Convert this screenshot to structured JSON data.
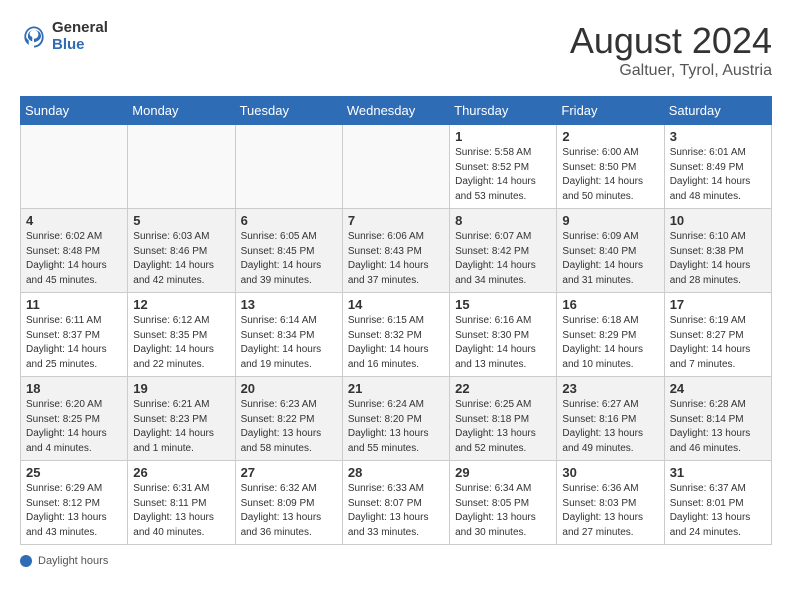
{
  "header": {
    "logo_general": "General",
    "logo_blue": "Blue",
    "month_title": "August 2024",
    "location": "Galtuer, Tyrol, Austria"
  },
  "weekdays": [
    "Sunday",
    "Monday",
    "Tuesday",
    "Wednesday",
    "Thursday",
    "Friday",
    "Saturday"
  ],
  "days": [
    {
      "date": "",
      "empty": true
    },
    {
      "date": "",
      "empty": true
    },
    {
      "date": "",
      "empty": true
    },
    {
      "date": "",
      "empty": true
    },
    {
      "date": "1",
      "sunrise": "5:58 AM",
      "sunset": "8:52 PM",
      "hours": "14 hours",
      "minutes": "and 53 minutes."
    },
    {
      "date": "2",
      "sunrise": "6:00 AM",
      "sunset": "8:50 PM",
      "hours": "14 hours",
      "minutes": "and 50 minutes."
    },
    {
      "date": "3",
      "sunrise": "6:01 AM",
      "sunset": "8:49 PM",
      "hours": "14 hours",
      "minutes": "and 48 minutes."
    },
    {
      "date": "4",
      "sunrise": "6:02 AM",
      "sunset": "8:48 PM",
      "hours": "14 hours",
      "minutes": "and 45 minutes."
    },
    {
      "date": "5",
      "sunrise": "6:03 AM",
      "sunset": "8:46 PM",
      "hours": "14 hours",
      "minutes": "and 42 minutes."
    },
    {
      "date": "6",
      "sunrise": "6:05 AM",
      "sunset": "8:45 PM",
      "hours": "14 hours",
      "minutes": "and 39 minutes."
    },
    {
      "date": "7",
      "sunrise": "6:06 AM",
      "sunset": "8:43 PM",
      "hours": "14 hours",
      "minutes": "and 37 minutes."
    },
    {
      "date": "8",
      "sunrise": "6:07 AM",
      "sunset": "8:42 PM",
      "hours": "14 hours",
      "minutes": "and 34 minutes."
    },
    {
      "date": "9",
      "sunrise": "6:09 AM",
      "sunset": "8:40 PM",
      "hours": "14 hours",
      "minutes": "and 31 minutes."
    },
    {
      "date": "10",
      "sunrise": "6:10 AM",
      "sunset": "8:38 PM",
      "hours": "14 hours",
      "minutes": "and 28 minutes."
    },
    {
      "date": "11",
      "sunrise": "6:11 AM",
      "sunset": "8:37 PM",
      "hours": "14 hours",
      "minutes": "and 25 minutes."
    },
    {
      "date": "12",
      "sunrise": "6:12 AM",
      "sunset": "8:35 PM",
      "hours": "14 hours",
      "minutes": "and 22 minutes."
    },
    {
      "date": "13",
      "sunrise": "6:14 AM",
      "sunset": "8:34 PM",
      "hours": "14 hours",
      "minutes": "and 19 minutes."
    },
    {
      "date": "14",
      "sunrise": "6:15 AM",
      "sunset": "8:32 PM",
      "hours": "14 hours",
      "minutes": "and 16 minutes."
    },
    {
      "date": "15",
      "sunrise": "6:16 AM",
      "sunset": "8:30 PM",
      "hours": "14 hours",
      "minutes": "and 13 minutes."
    },
    {
      "date": "16",
      "sunrise": "6:18 AM",
      "sunset": "8:29 PM",
      "hours": "14 hours",
      "minutes": "and 10 minutes."
    },
    {
      "date": "17",
      "sunrise": "6:19 AM",
      "sunset": "8:27 PM",
      "hours": "14 hours",
      "minutes": "and 7 minutes."
    },
    {
      "date": "18",
      "sunrise": "6:20 AM",
      "sunset": "8:25 PM",
      "hours": "14 hours",
      "minutes": "and 4 minutes."
    },
    {
      "date": "19",
      "sunrise": "6:21 AM",
      "sunset": "8:23 PM",
      "hours": "14 hours",
      "minutes": "and 1 minute."
    },
    {
      "date": "20",
      "sunrise": "6:23 AM",
      "sunset": "8:22 PM",
      "hours": "13 hours",
      "minutes": "and 58 minutes."
    },
    {
      "date": "21",
      "sunrise": "6:24 AM",
      "sunset": "8:20 PM",
      "hours": "13 hours",
      "minutes": "and 55 minutes."
    },
    {
      "date": "22",
      "sunrise": "6:25 AM",
      "sunset": "8:18 PM",
      "hours": "13 hours",
      "minutes": "and 52 minutes."
    },
    {
      "date": "23",
      "sunrise": "6:27 AM",
      "sunset": "8:16 PM",
      "hours": "13 hours",
      "minutes": "and 49 minutes."
    },
    {
      "date": "24",
      "sunrise": "6:28 AM",
      "sunset": "8:14 PM",
      "hours": "13 hours",
      "minutes": "and 46 minutes."
    },
    {
      "date": "25",
      "sunrise": "6:29 AM",
      "sunset": "8:12 PM",
      "hours": "13 hours",
      "minutes": "and 43 minutes."
    },
    {
      "date": "26",
      "sunrise": "6:31 AM",
      "sunset": "8:11 PM",
      "hours": "13 hours",
      "minutes": "and 40 minutes."
    },
    {
      "date": "27",
      "sunrise": "6:32 AM",
      "sunset": "8:09 PM",
      "hours": "13 hours",
      "minutes": "and 36 minutes."
    },
    {
      "date": "28",
      "sunrise": "6:33 AM",
      "sunset": "8:07 PM",
      "hours": "13 hours",
      "minutes": "and 33 minutes."
    },
    {
      "date": "29",
      "sunrise": "6:34 AM",
      "sunset": "8:05 PM",
      "hours": "13 hours",
      "minutes": "and 30 minutes."
    },
    {
      "date": "30",
      "sunrise": "6:36 AM",
      "sunset": "8:03 PM",
      "hours": "13 hours",
      "minutes": "and 27 minutes."
    },
    {
      "date": "31",
      "sunrise": "6:37 AM",
      "sunset": "8:01 PM",
      "hours": "13 hours",
      "minutes": "and 24 minutes."
    }
  ],
  "legend": {
    "text": "Daylight hours"
  },
  "labels": {
    "sunrise_prefix": "Sunrise: ",
    "sunset_prefix": "Sunset: ",
    "daylight_prefix": "Daylight: "
  }
}
